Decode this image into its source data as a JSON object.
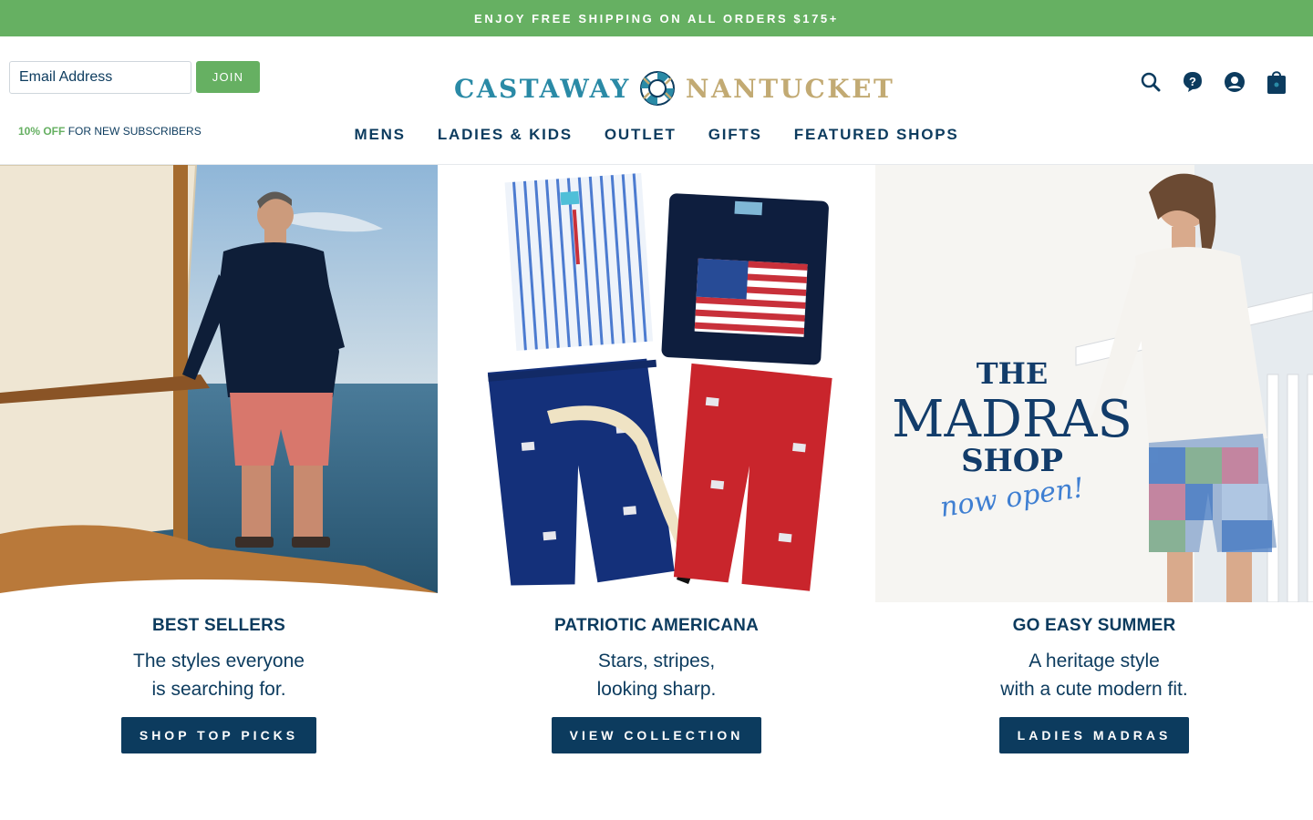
{
  "announcement": {
    "text": "ENJOY FREE SHIPPING ON ALL ORDERS $175+"
  },
  "newsletter": {
    "placeholder": "Email Address",
    "join_label": "JOIN",
    "promo_highlight": "10% OFF",
    "promo_rest": " FOR NEW SUBSCRIBERS"
  },
  "logo": {
    "word1": "CASTAWAY",
    "word2": "NANTUCKET"
  },
  "header_icons": [
    "search-icon",
    "help-icon",
    "account-icon",
    "cart-icon"
  ],
  "nav": {
    "items": [
      {
        "label": "MENS"
      },
      {
        "label": "LADIES & KIDS"
      },
      {
        "label": "OUTLET"
      },
      {
        "label": "GIFTS"
      },
      {
        "label": "FEATURED SHOPS"
      }
    ]
  },
  "tiles": [
    {
      "title": "BEST SELLERS",
      "line1": "The styles everyone",
      "line2": "is searching for.",
      "cta": "SHOP TOP PICKS"
    },
    {
      "title": "PATRIOTIC AMERICANA",
      "line1": "Stars, stripes,",
      "line2": "looking sharp.",
      "cta": "VIEW COLLECTION"
    },
    {
      "title": "GO EASY SUMMER",
      "line1": "A heritage style",
      "line2": "with a cute modern fit.",
      "cta": "LADIES MADRAS"
    }
  ],
  "madras_badge": {
    "line1": "THE",
    "line2": "MADRAS",
    "line3": "SHOP",
    "line4": "now open!"
  },
  "colors": {
    "green": "#66b062",
    "navy": "#0c3b5e",
    "teal": "#2a8aa6",
    "gold": "#c2aa73"
  }
}
